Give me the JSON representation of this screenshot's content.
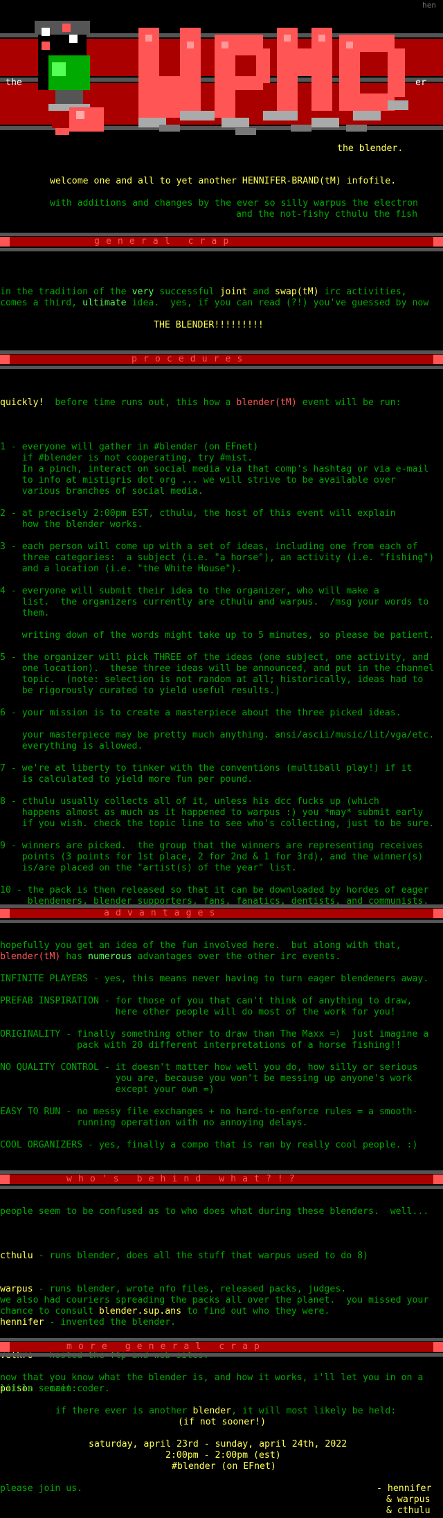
{
  "corner_tag": "hen",
  "banner": {
    "left_text": "the",
    "right_text": "er",
    "subtitle": "the blender."
  },
  "intro": {
    "welcome": "welcome one and all to yet another HENNIFER-BRAND(tM) infofile.",
    "line2": "with additions and changes by the ever so silly warpus the electron",
    "line3": "and the not-fishy cthulu the fish"
  },
  "sections": {
    "general": "general crap",
    "procedures": "procedures",
    "advantages": "advantages",
    "who": "who's behind what?!?",
    "more": "more general crap"
  },
  "general": {
    "l1a": "in the tradition of the ",
    "very": "very",
    "l1b": " successful ",
    "joint": "joint",
    "l1c": " and ",
    "swap": "swap(tM)",
    "l1d": " irc activities,",
    "l2a": "comes a third, ",
    "ultimate": "ultimate",
    "l2b": " idea.  yes, if you can read (?!) you've guessed by now",
    "headline": "THE BLENDER!!!!!!!!!"
  },
  "procedures": {
    "intro_quickly": "quickly!",
    "intro_a": "  before time runs out, this how a ",
    "intro_blender": "blender(tM)",
    "intro_b": " event will be run:",
    "p1": [
      "1 - everyone will gather in #blender (on EFnet)",
      "    if #blender is not cooperating, try #mist.",
      "    In a pinch, interact on social media via that comp's hashtag or via e-mail",
      "    to info at mistigris dot org ... we will strive to be available over",
      "    various branches of social media."
    ],
    "p2": [
      "2 - at precisely 2:00pm EST, cthulu, the host of this event will explain",
      "    how the blender works."
    ],
    "p3": [
      "3 - each person will come up with a set of ideas, including one from each of",
      "    three categories:  a subject (i.e. \"a horse\"), an activity (i.e. \"fishing\")",
      "    and a location (i.e. \"the White House\")."
    ],
    "p4": [
      "4 - everyone will submit their idea to the organizer, who will make a",
      "    list.  the organizers currently are cthulu and warpus.  /msg your words to",
      "    them.",
      "",
      "    writing down of the words might take up to 5 minutes, so please be patient."
    ],
    "p5": [
      "5 - the organizer will pick THREE of the ideas (one subject, one activity, and",
      "    one location).  these three ideas will be announced, and put in the channel",
      "    topic.  (note: selection is not random at all; historically, ideas had to",
      "    be rigorously curated to yield useful results.)"
    ],
    "p6": [
      "6 - your mission is to create a masterpiece about the three picked ideas.",
      "",
      "    your masterpiece may be pretty much anything. ansi/ascii/music/lit/vga/etc.",
      "    everything is allowed."
    ],
    "p7": [
      "7 - we're at liberty to tinker with the conventions (multiball play!) if it",
      "    is calculated to yield more fun per pound."
    ],
    "p8": [
      "8 - cthulu usually collects all of it, unless his dcc fucks up (which",
      "    happens almost as much as it happened to warpus :) you *may* submit early",
      "    if you wish. check the topic line to see who's collecting, just to be sure."
    ],
    "p9": [
      "9 - winners are picked.  the group that the winners are representing receives",
      "    points (3 points for 1st place, 2 for 2nd & 1 for 3rd), and the winner(s)",
      "    is/are placed on the \"artist(s) of the year\" list."
    ],
    "p10": [
      "10 - the pack is then released so that it can be downloaded by hordes of eager",
      "     blendeners, blender supporters, fans, fanatics, dentists, and communists."
    ]
  },
  "advantages": {
    "intro1": "hopefully you get an idea of the fun involved here.  but along with that,",
    "intro2_a": "blender(tM)",
    "intro2_b": " has ",
    "intro2_c": "numerous",
    "intro2_d": " advantages over the other irc events.",
    "items": [
      [
        "INFINITE PLAYERS - yes, this means never having to turn eager blendeners away."
      ],
      [
        "PREFAB INSPIRATION - for those of you that can't think of anything to draw,",
        "                     here other people will do most of the work for you!"
      ],
      [
        "ORIGINALITY - finally something other to draw than The Maxx =)  just imagine a",
        "              pack with 20 different interpretations of a horse fishing!!"
      ],
      [
        "NO QUALITY CONTROL - it doesn't matter how well you do, how silly or serious",
        "                     you are, because you won't be messing up anyone's work",
        "                     except your own =)"
      ],
      [
        "EASY TO RUN - no messy file exchanges + no hard-to-enforce rules = a smooth-",
        "              running operation with no annoying delays."
      ],
      [
        "COOL ORGANIZERS - yes, finally a compo that is ran by really cool people. :)"
      ]
    ]
  },
  "who": {
    "intro": "people seem to be confused as to who does what during these blenders.  well...",
    "people": [
      {
        "name": "cthulu",
        "role": " - runs blender, does all the stuff that warpus used to do 8)"
      },
      {
        "name": "warpus",
        "role": " - runs blender, wrote nfo files, released packs, judges."
      },
      {
        "name": "hennifer",
        "role": " - invented the blender."
      },
      {
        "name": "velkro",
        "role": " - hosted the ftp and web sites."
      },
      {
        "name": "poison",
        "role": " - main coder."
      }
    ],
    "couriers1": "we also had couriers spreading the packs all over the planet.  you missed your",
    "couriers2_a": "chance to consult ",
    "couriers2_b": "blender.sup.ans",
    "couriers2_c": " to find out who they were."
  },
  "more": {
    "l1": "now that you know what the blender is, and how it works, i'll let you in on a",
    "l2": "little secret:",
    "l3a": "if there ever is another ",
    "l3b": "blender",
    "l3c": ", it will most likely be held:",
    "l4": "(if not sooner!)",
    "l5": "saturday, april 23rd - sunday, april 24th, 2022",
    "l6": "2:00pm - 2:00pm (est)",
    "l7": "#blender (on EFnet)",
    "join": "please join us.",
    "sig1": "- hennifer",
    "sig2": "& warpus",
    "sig3": "& cthulu"
  },
  "colors": {
    "dark_green": "#00aa00",
    "bright_green": "#55ff55",
    "yellow": "#ffff55",
    "light_red": "#ff5555",
    "dark_red": "#aa0000",
    "gray": "#555555",
    "white": "#ffffff"
  }
}
